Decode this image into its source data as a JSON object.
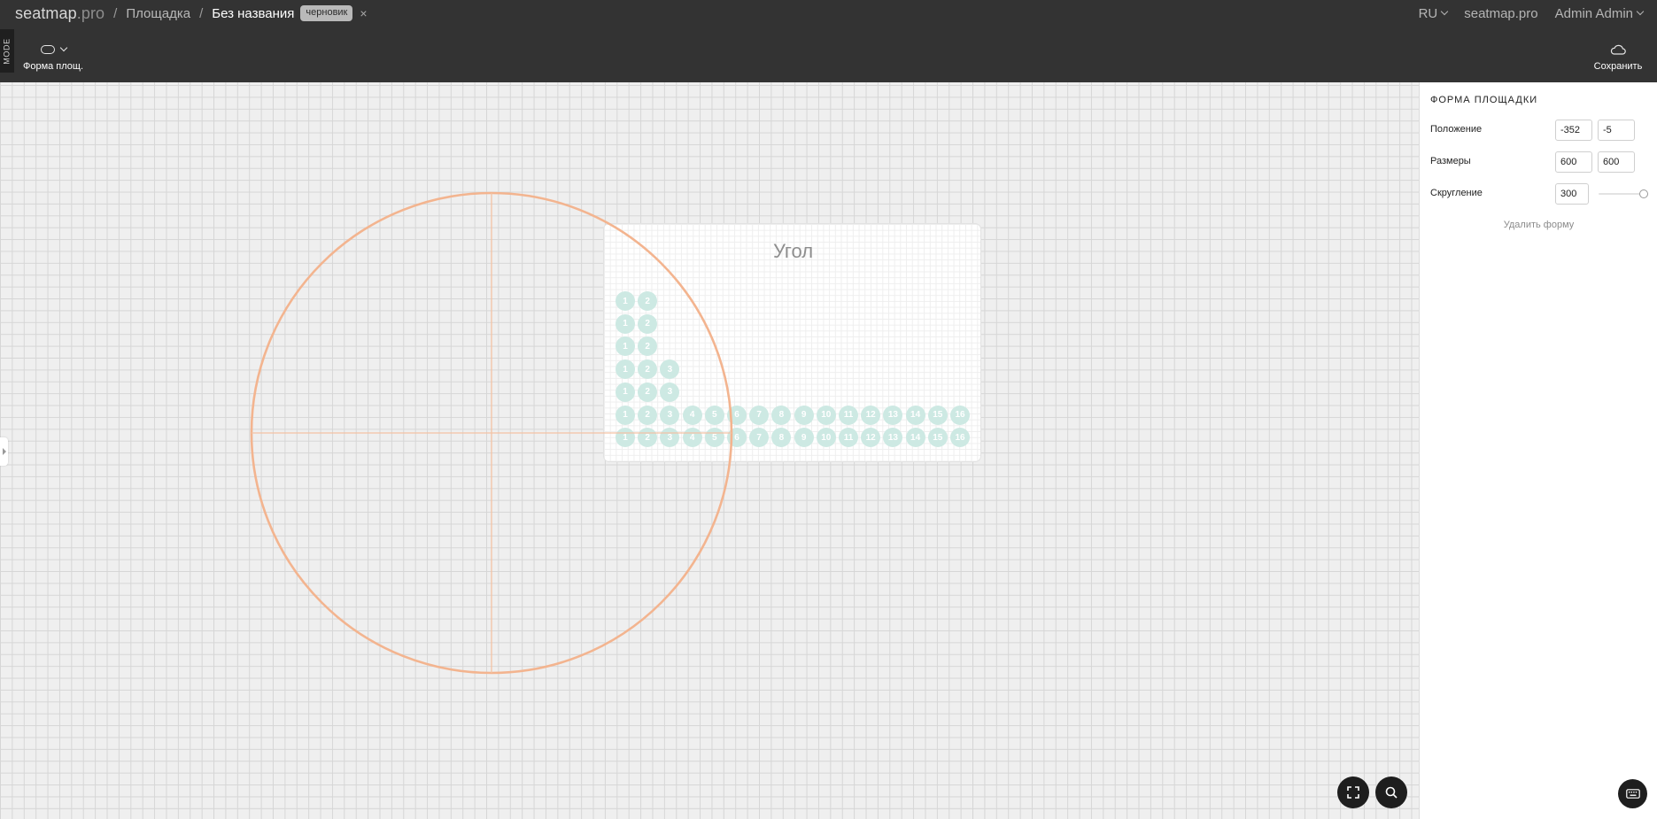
{
  "breadcrumb": {
    "brand_main": "seatmap",
    "brand_tld": ".pro",
    "separator": "/",
    "venue": "Площадка",
    "current": "Без названия",
    "status_badge": "черновик",
    "close_symbol": "×"
  },
  "topbar_right": {
    "language": "RU",
    "workspace": "seatmap.pro",
    "user": "Admin Admin"
  },
  "mode_strip": "MODE",
  "toolbar": {
    "shape_tool_label": "Форма площ.",
    "save_label": "Сохранить"
  },
  "section": {
    "title": "Угол",
    "rows": [
      [
        1,
        2
      ],
      [
        1,
        2
      ],
      [
        1,
        2
      ],
      [
        1,
        2,
        3
      ],
      [
        1,
        2,
        3
      ],
      [
        1,
        2,
        3,
        4,
        5,
        6,
        7,
        8,
        9,
        10,
        11,
        12,
        13,
        14,
        15,
        16
      ],
      [
        1,
        2,
        3,
        4,
        5,
        6,
        7,
        8,
        9,
        10,
        11,
        12,
        13,
        14,
        15,
        16
      ]
    ]
  },
  "panel": {
    "title": "ФОРМА ПЛОЩАДКИ",
    "position_label": "Положение",
    "position_x": "-352",
    "position_y": "-5",
    "size_label": "Размеры",
    "size_w": "600",
    "size_h": "600",
    "rounding_label": "Скругление",
    "rounding_value": "300",
    "rounding_fraction": 1.0,
    "delete_label": "Удалить форму"
  },
  "colors": {
    "topbar": "#333333",
    "shape_outline": "#f3b48f",
    "seat": "#cde9e3"
  },
  "icons": {
    "shape_tool": "rounded-rect-icon",
    "save": "cloud-icon",
    "fit": "fullscreen-icon",
    "zoom": "search-icon",
    "keyboard": "keyboard-icon"
  }
}
